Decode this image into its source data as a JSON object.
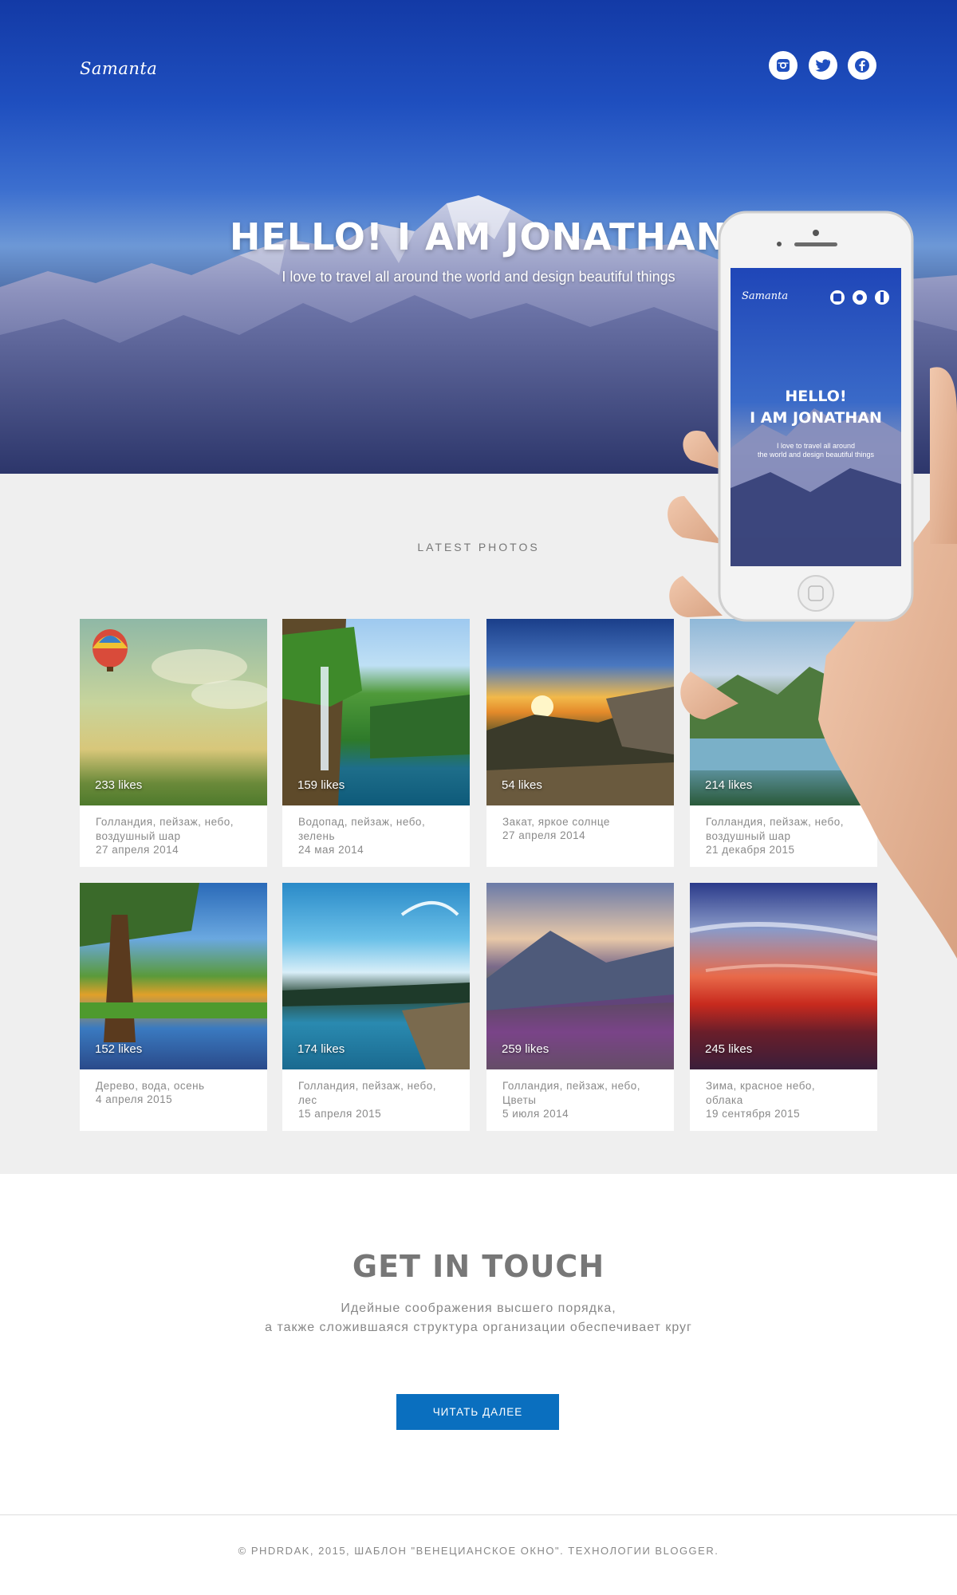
{
  "hero": {
    "logo": "Samanta",
    "title": "HELLO! I AM JONATHAN",
    "subtitle": "I love to travel all around the world and design beautiful things",
    "social_icons": [
      "instagram-icon",
      "twitter-icon",
      "facebook-icon"
    ]
  },
  "phone": {
    "logo": "Samanta",
    "title_line1": "HELLO!",
    "title_line2": "I AM JONATHAN",
    "sub_line1": "I love to travel all around",
    "sub_line2": "the world and design beautiful things"
  },
  "photos": {
    "section_label": "LATEST PHOTOS",
    "cards": [
      {
        "likes": "233 likes",
        "caption1": "Голландия, пейзаж, небо,",
        "caption2": "воздушный шар",
        "date": "27 апреля 2014"
      },
      {
        "likes": "159 likes",
        "caption1": "Водопад, пейзаж, небо,",
        "caption2": "зелень",
        "date": "24 мая 2014"
      },
      {
        "likes": "54 likes",
        "caption1": "Закат, яркое солнце",
        "caption2": "",
        "date": "27 апреля 2014"
      },
      {
        "likes": "214 likes",
        "caption1": "Голландия, пейзаж, небо,",
        "caption2": "воздушный шар",
        "date": "21 декабря 2015"
      },
      {
        "likes": "152 likes",
        "caption1": "Дерево, вода, осень",
        "caption2": "",
        "date": "4 апреля 2015"
      },
      {
        "likes": "174 likes",
        "caption1": "Голландия, пейзаж, небо,",
        "caption2": "лес",
        "date": "15 апреля 2015"
      },
      {
        "likes": "259 likes",
        "caption1": "Голландия, пейзаж, небо,",
        "caption2": "Цветы",
        "date": "5 июля 2014"
      },
      {
        "likes": "245 likes",
        "caption1": "Зима, красное небо,",
        "caption2": "облака",
        "date": "19 сентября 2015"
      }
    ]
  },
  "contact": {
    "title": "GET IN TOUCH",
    "line1": "Идейные соображения высшего порядка,",
    "line2": "а также сложившаяся структура организации обеспечивает круг",
    "button_label": "ЧИТАТЬ ДАЛЕЕ"
  },
  "footer": {
    "text": "© PHDRDAK, 2015, ШАБЛОН \"ВЕНЕЦИАНСКОЕ ОКНО\". ТЕХНОЛОГИИ BLOGGER."
  },
  "colors": {
    "hero_blue": "#1f4fbf",
    "button_blue": "#0a6fbf",
    "section_bg": "#efefef"
  }
}
